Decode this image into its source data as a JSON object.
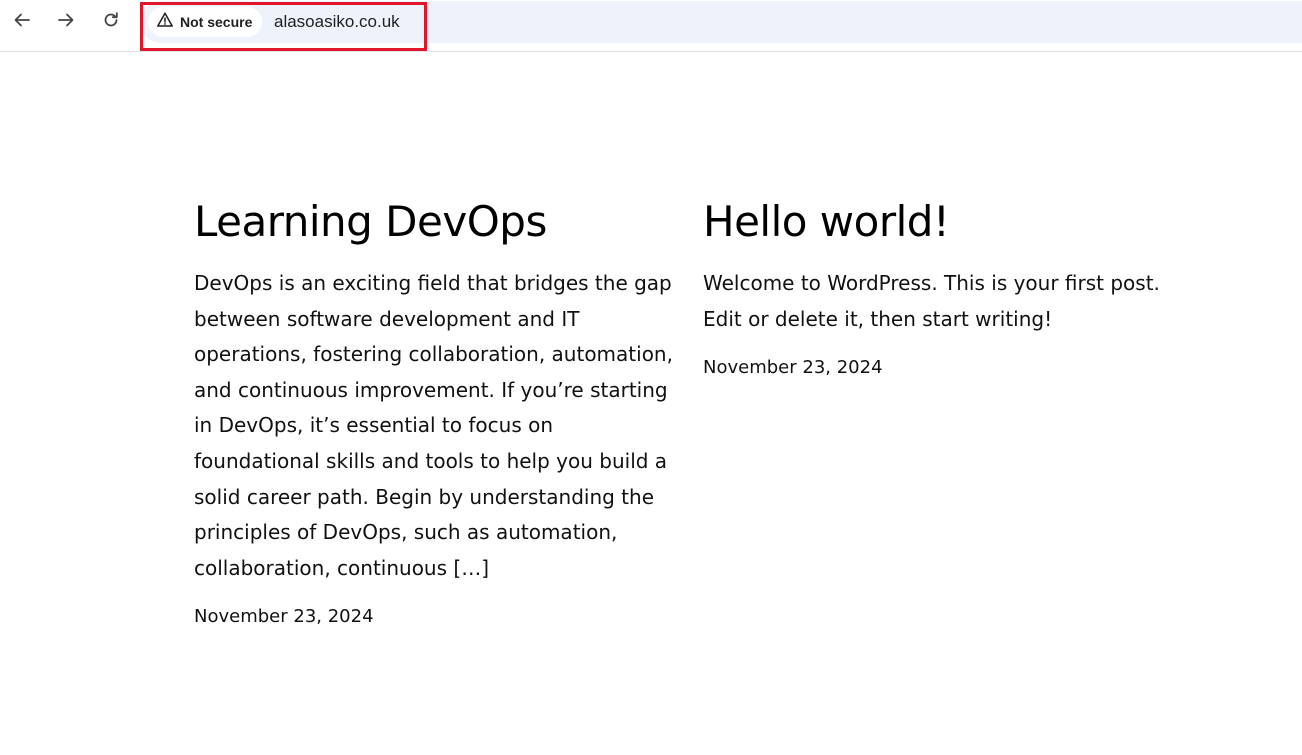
{
  "browser": {
    "nav": {
      "back_icon": "arrow-left-icon",
      "forward_icon": "arrow-right-icon",
      "reload_icon": "reload-icon"
    },
    "address_bar": {
      "security_icon": "warning-triangle-icon",
      "security_label": "Not secure",
      "url": "alasoasiko.co.uk"
    },
    "highlight_color": "#e0162b"
  },
  "posts": [
    {
      "title": "Learning DevOps",
      "excerpt": "DevOps is an exciting field that bridges the gap between software development and IT operations, fostering collaboration, automation, and continuous improvement. If you’re starting in DevOps, it’s essential to focus on foundational skills and tools to help you build a solid career path. Begin by understanding the principles of DevOps, such as automation, collaboration, continuous […]",
      "date": "November 23, 2024"
    },
    {
      "title": "Hello world!",
      "excerpt": "Welcome to WordPress. This is your first post. Edit or delete it, then start writing!",
      "date": "November 23, 2024"
    }
  ]
}
